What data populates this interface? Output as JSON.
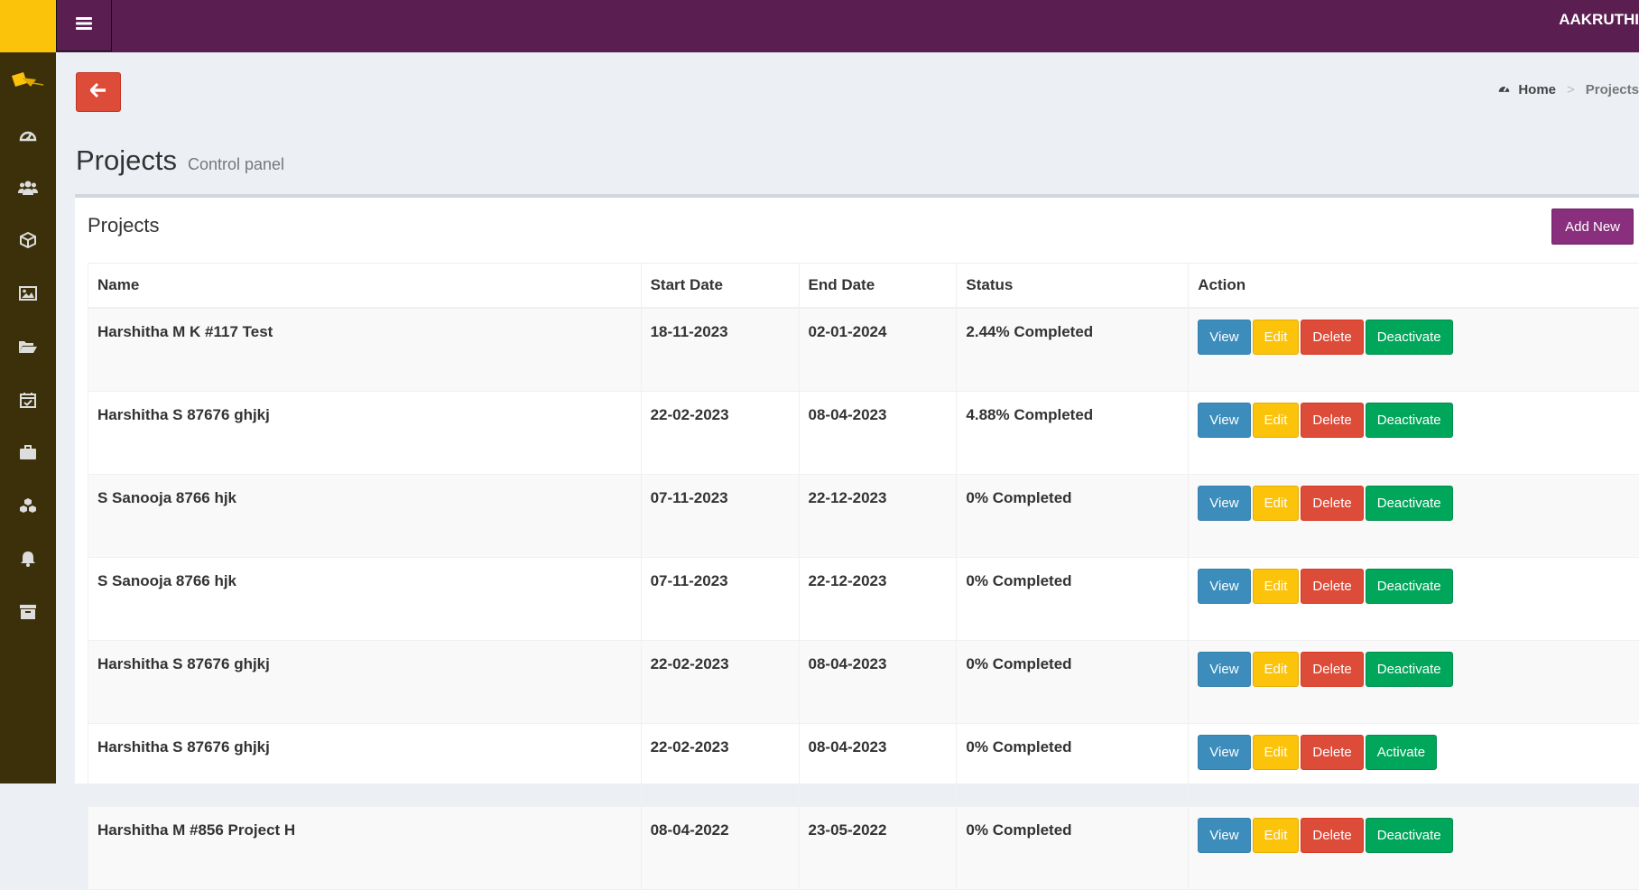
{
  "header": {
    "user_name": "AAKRUTHI"
  },
  "breadcrumb": {
    "home": "Home",
    "separator": ">",
    "current": "Projects"
  },
  "page": {
    "title": "Projects",
    "subtitle": "Control panel"
  },
  "box": {
    "title": "Projects",
    "add_new_label": "Add New"
  },
  "sidebar": {
    "icons": [
      "dashboard-icon",
      "users-icon",
      "cube-icon",
      "image-icon",
      "folder-open-icon",
      "calendar-check-icon",
      "briefcase-icon",
      "cubes-icon",
      "bell-icon",
      "archive-icon"
    ]
  },
  "table": {
    "headers": {
      "name": "Name",
      "start": "Start Date",
      "end": "End Date",
      "status": "Status",
      "action": "Action"
    },
    "rows": [
      {
        "name": "Harshitha M K #117 Test",
        "start": "18-11-2023",
        "end": "02-01-2024",
        "status": "2.44% Completed",
        "view": "View",
        "edit": "Edit",
        "delete": "Delete",
        "toggle": "Deactivate"
      },
      {
        "name": "Harshitha S 87676 ghjkj",
        "start": "22-02-2023",
        "end": "08-04-2023",
        "status": "4.88% Completed",
        "view": "View",
        "edit": "Edit",
        "delete": "Delete",
        "toggle": "Deactivate"
      },
      {
        "name": "S Sanooja 8766 hjk",
        "start": "07-11-2023",
        "end": "22-12-2023",
        "status": "0% Completed",
        "view": "View",
        "edit": "Edit",
        "delete": "Delete",
        "toggle": "Deactivate"
      },
      {
        "name": "S Sanooja 8766 hjk",
        "start": "07-11-2023",
        "end": "22-12-2023",
        "status": "0% Completed",
        "view": "View",
        "edit": "Edit",
        "delete": "Delete",
        "toggle": "Deactivate"
      },
      {
        "name": "Harshitha S 87676 ghjkj",
        "start": "22-02-2023",
        "end": "08-04-2023",
        "status": "0% Completed",
        "view": "View",
        "edit": "Edit",
        "delete": "Delete",
        "toggle": "Deactivate"
      },
      {
        "name": "Harshitha S 87676 ghjkj",
        "start": "22-02-2023",
        "end": "08-04-2023",
        "status": "0% Completed",
        "view": "View",
        "edit": "Edit",
        "delete": "Delete",
        "toggle": "Activate"
      },
      {
        "name": "Harshitha M #856 Project H",
        "start": "08-04-2022",
        "end": "23-05-2022",
        "status": "0% Completed",
        "view": "View",
        "edit": "Edit",
        "delete": "Delete",
        "toggle": "Deactivate"
      }
    ]
  },
  "colors": {
    "navbar": "#5a1f50",
    "sidebar": "#3b300a",
    "logo_bg": "#fcc30b",
    "view": "#3c8dbc",
    "edit": "#fcc30b",
    "delete": "#dd4b39",
    "toggle": "#00a65a",
    "add_new": "#8a2f7e"
  }
}
